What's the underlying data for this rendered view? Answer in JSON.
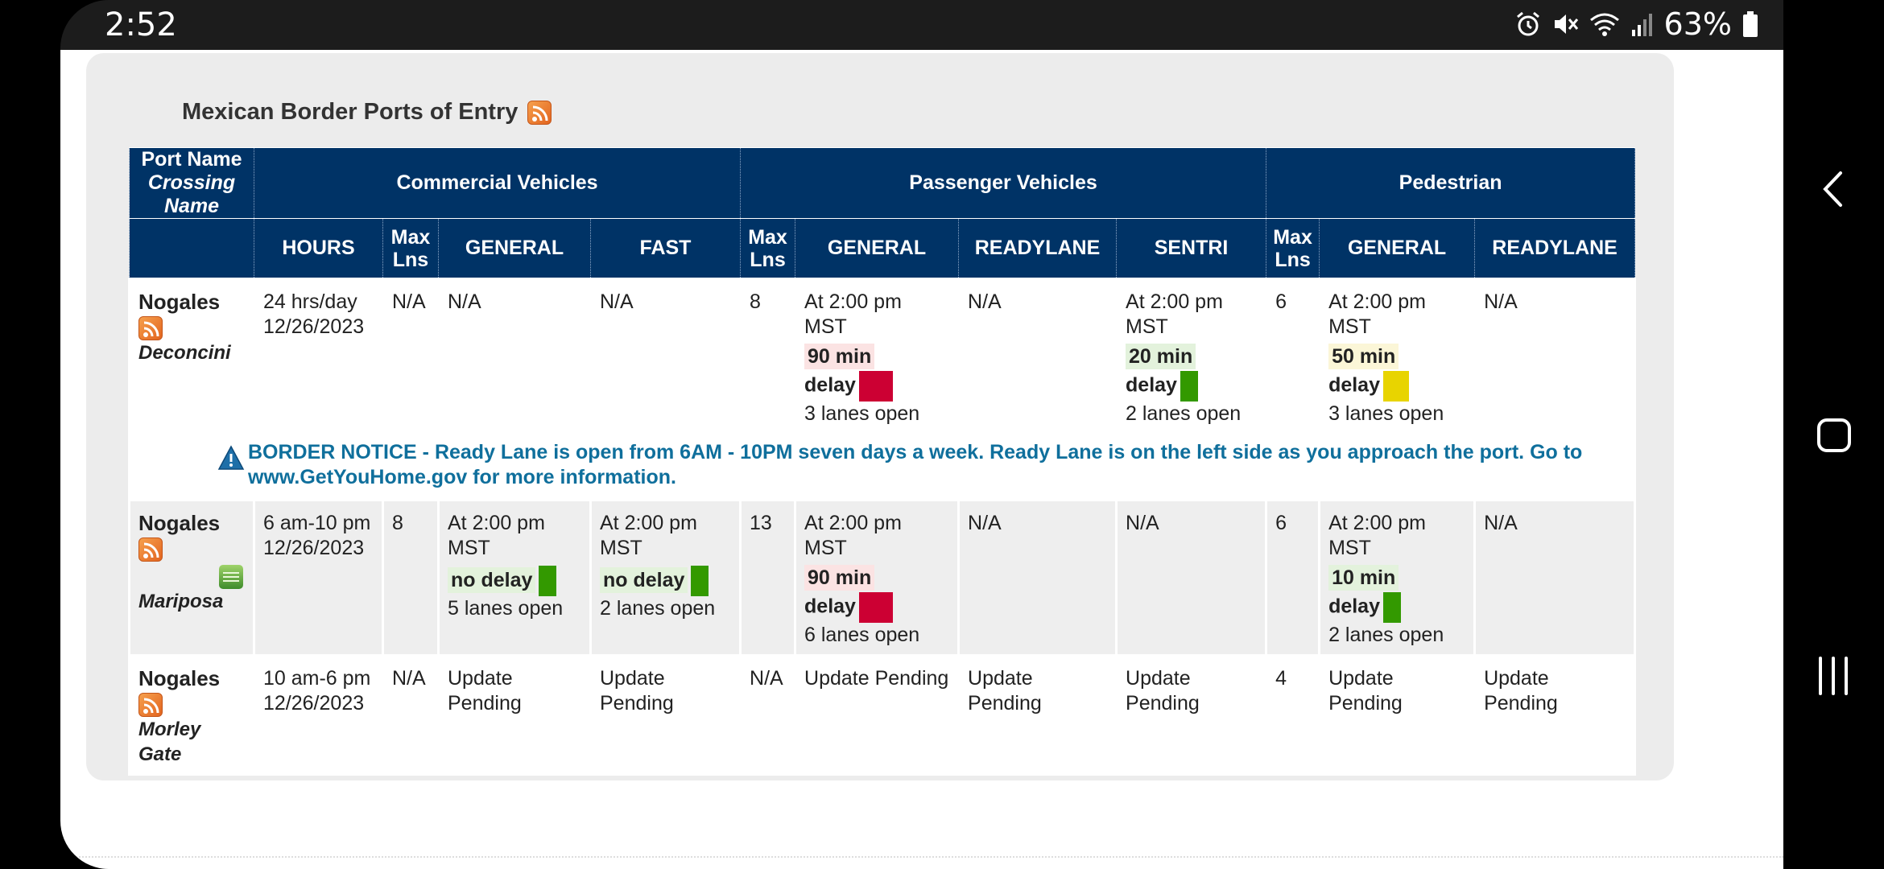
{
  "status_bar": {
    "time": "2:52",
    "battery": "63%",
    "icons": [
      "alarm-icon",
      "mute-icon",
      "wifi-icon",
      "signal-icon",
      "battery-icon"
    ]
  },
  "page": {
    "section_title": "Mexican Border Ports of Entry",
    "headers": {
      "port_name": "Port Name",
      "crossing_name": "Crossing Name",
      "commercial": "Commercial Vehicles",
      "passenger": "Passenger Vehicles",
      "pedestrian": "Pedestrian",
      "hours": "HOURS",
      "max_lns": "Max Lns",
      "general": "GENERAL",
      "fast": "FAST",
      "readylane": "READYLANE",
      "sentri": "SENTRI"
    },
    "rows": [
      {
        "port": "Nogales",
        "crossing": "Deconcini",
        "hours": "24 hrs/day",
        "date": "12/26/2023",
        "com_max": "N/A",
        "com_general": "N/A",
        "com_fast": "N/A",
        "pass_max": "8",
        "pass_general": {
          "time": "At 2:00 pm MST",
          "delay_a": "90 min",
          "delay_b": "delay",
          "lanes": "3 lanes open"
        },
        "pass_ready": "N/A",
        "pass_sentri": {
          "time": "At 2:00 pm MST",
          "delay_a": "20 min",
          "delay_b": "delay",
          "lanes": "2 lanes open"
        },
        "ped_max": "6",
        "ped_general": {
          "time": "At 2:00 pm MST",
          "delay_a": "50 min",
          "delay_b": "delay",
          "lanes": "3 lanes open"
        },
        "ped_ready": "N/A"
      },
      {
        "port": "Nogales",
        "crossing": "Mariposa",
        "hours": "6 am-10 pm",
        "date": "12/26/2023",
        "com_max": "8",
        "com_general": {
          "time": "At 2:00 pm MST",
          "delay": "no delay",
          "lanes": "5 lanes open"
        },
        "com_fast": {
          "time": "At 2:00 pm MST",
          "delay": "no delay",
          "lanes": "2 lanes open"
        },
        "pass_max": "13",
        "pass_general": {
          "time": "At 2:00 pm MST",
          "delay_a": "90 min",
          "delay_b": "delay",
          "lanes": "6 lanes open"
        },
        "pass_ready": "N/A",
        "pass_sentri": "N/A",
        "ped_max": "6",
        "ped_general": {
          "time": "At 2:00 pm MST",
          "delay_a": "10 min",
          "delay_b": "delay",
          "lanes": "2 lanes open"
        },
        "ped_ready": "N/A"
      },
      {
        "port": "Nogales",
        "crossing": "Morley Gate",
        "hours": "10 am-6 pm",
        "date": "12/26/2023",
        "com_max": "N/A",
        "com_general": "Update Pending",
        "com_fast": "Update Pending",
        "pass_max": "N/A",
        "pass_general": "Update Pending",
        "pass_ready": "Update Pending",
        "pass_sentri": "Update Pending",
        "ped_max": "4",
        "ped_general": "Update Pending",
        "ped_ready": "Update Pending"
      }
    ],
    "notice": "BORDER NOTICE - Ready Lane is open from 6AM - 10PM seven days a week. Ready Lane is on the left side as you approach the port. Go to www.GetYouHome.gov for more information."
  },
  "colors": {
    "header_bg": "#003366",
    "delay_red": "#cc0033",
    "delay_green": "#339900",
    "delay_yellow": "#e8d400",
    "notice_text": "#0f6f9c"
  },
  "nav": {
    "icons": [
      "back-icon",
      "home-icon",
      "recents-icon"
    ]
  }
}
